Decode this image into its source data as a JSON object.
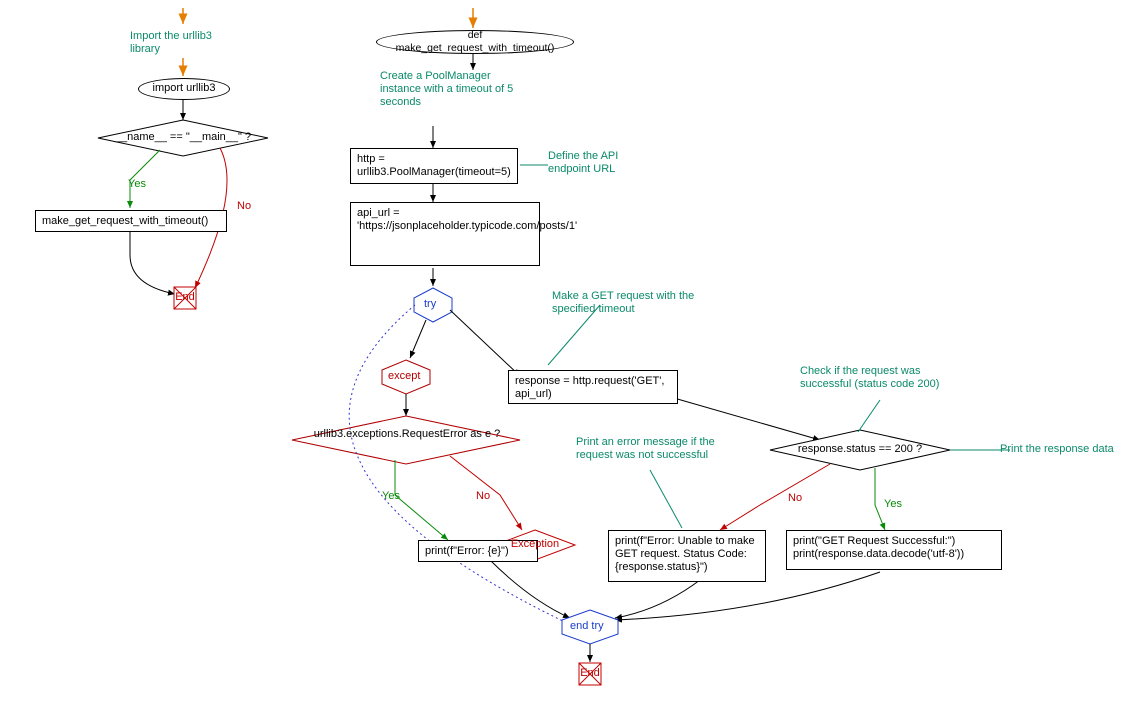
{
  "left": {
    "comment_import": "Import the urllib3 library",
    "import_stmt": "import urllib3",
    "cond_main": "__name__ == \"__main__\" ?",
    "yes": "Yes",
    "no": "No",
    "call_fn": "make_get_request_with_timeout()",
    "end": "End"
  },
  "right": {
    "def_fn": "def make_get_request_with_timeout()",
    "comment_pool": "Create a PoolManager instance with a timeout of 5 seconds",
    "http_stmt": "http = urllib3.PoolManager(timeout=5)",
    "comment_url": "Define the API endpoint URL",
    "api_url": "api_url = 'https://jsonplaceholder.typicode.com/posts/1'",
    "try": "try",
    "comment_get": "Make a GET request with the specified timeout",
    "response_stmt": "response = http.request('GET', api_url)",
    "comment_check": "Check if the request was successful (status code 200)",
    "cond_status": "response.status == 200 ?",
    "comment_print_data": "Print the response data",
    "print_success": "print(\"GET Request Successful:\")\nprint(response.data.decode('utf-8'))",
    "print_error": "print(f\"Error: Unable to make GET request. Status Code: {response.status}\")",
    "comment_error": "Print an error message if the request was not successful",
    "except": "except",
    "cond_except": "urllib3.exceptions.RequestError as e ?",
    "print_e": "print(f\"Error: {e}\")",
    "exception": "Exception",
    "end_try": "end try",
    "end": "End",
    "yes": "Yes",
    "no": "No"
  },
  "colors": {
    "comment": "#0a8a6a",
    "yes": "#0a8a0a",
    "no": "#c00000",
    "arrow_orange": "#e67e00",
    "try_blue": "#1a3ccc",
    "except_red": "#b00000",
    "dotted_blue": "#3333cc"
  }
}
